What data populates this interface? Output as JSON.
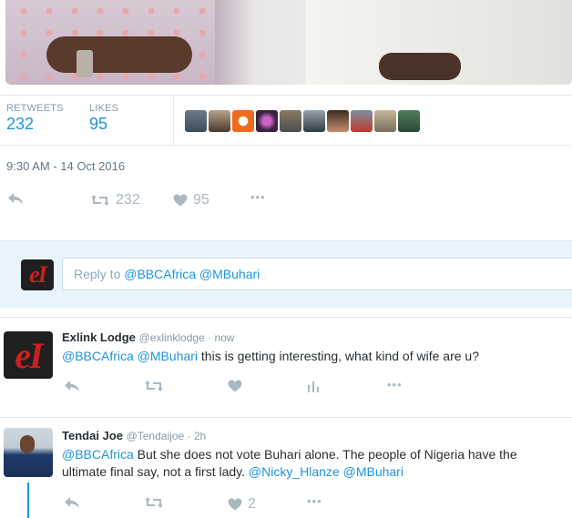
{
  "stats": {
    "retweets_label": "RETWEETS",
    "retweets_value": "232",
    "likes_label": "LIKES",
    "likes_value": "95"
  },
  "timestamp": "9:30 AM - 14 Oct 2016",
  "main_actions": {
    "retweet_count": "232",
    "like_count": "95",
    "more": "•••"
  },
  "reply": {
    "prefix": "Reply to ",
    "mentions": "@BBCAfrica @MBuhari"
  },
  "tweets": [
    {
      "name": "Exlink Lodge",
      "handle": "@exlinklodge",
      "sep": " · ",
      "time": "now",
      "mentions": "@BBCAfrica @MBuhari",
      "text": " this is getting interesting, what kind of wife are u?",
      "more": "•••"
    },
    {
      "name": "Tendai Joe",
      "handle": "@Tendaijoe",
      "sep": " · ",
      "time": "2h",
      "mention1": "@BBCAfrica",
      "line1": " But she does not vote Buhari alone. The people of Nigeria have the",
      "line2": "ultimate final say, not a first lady. ",
      "mention2": "@Nicky_Hlanze",
      "mention3": "@MBuhari",
      "like_count": "2",
      "more": "•••"
    }
  ],
  "logo_text": "eI",
  "colors": {
    "accent": "#1b95e0",
    "muted": "#aab8c2",
    "reply_bg": "#e8f4fb"
  }
}
